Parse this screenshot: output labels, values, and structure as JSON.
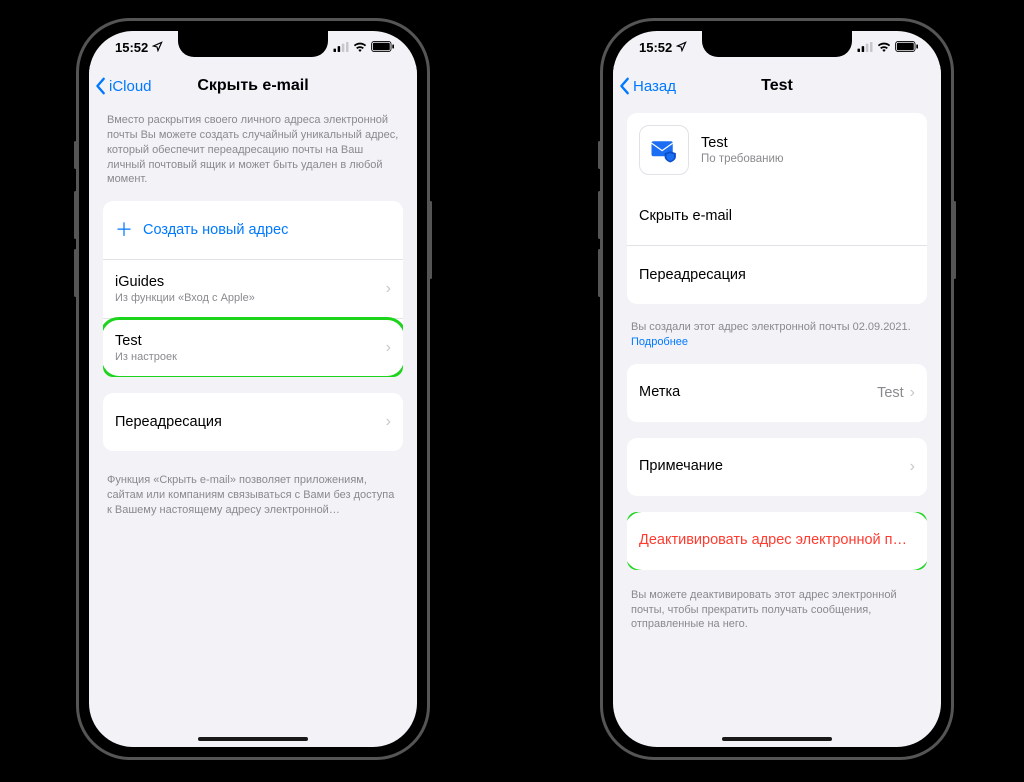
{
  "status": {
    "time": "15:52",
    "location_icon": "location-arrow",
    "signal": "cell-signal",
    "wifi": "wifi",
    "battery": "battery-full"
  },
  "left": {
    "back_label": "iCloud",
    "title": "Скрыть e-mail",
    "intro": "Вместо раскрытия своего личного адреса электронной почты Вы можете создать случайный уникальный адрес, который обеспечит переадресацию почты на Ваш личный почтовый ящик и может быть удален в любой момент.",
    "create_label": "Создать новый адрес",
    "items": [
      {
        "title": "iGuides",
        "sub": "Из функции «Вход с Apple»"
      },
      {
        "title": "Test",
        "sub": "Из настроек"
      }
    ],
    "forward_label": "Переадресация",
    "footer": "Функция «Скрыть e-mail» позволяет приложениям, сайтам или компаниям связываться с Вами без доступа к Вашему настоящему адресу электронной…"
  },
  "right": {
    "back_label": "Назад",
    "title": "Test",
    "card": {
      "title": "Test",
      "sub": "По требованию"
    },
    "hide_label": "Скрыть e-mail",
    "forward_label": "Переадресация",
    "created_note": "Вы создали этот адрес электронной почты 02.09.2021.",
    "more_label": "Подробнее",
    "label_row": {
      "title": "Метка",
      "value": "Test"
    },
    "note_row": "Примечание",
    "deactivate": "Деактивировать адрес электронной п…",
    "footer": "Вы можете деактивировать этот адрес электронной почты, чтобы прекратить получать сообщения, отправленные на него."
  }
}
